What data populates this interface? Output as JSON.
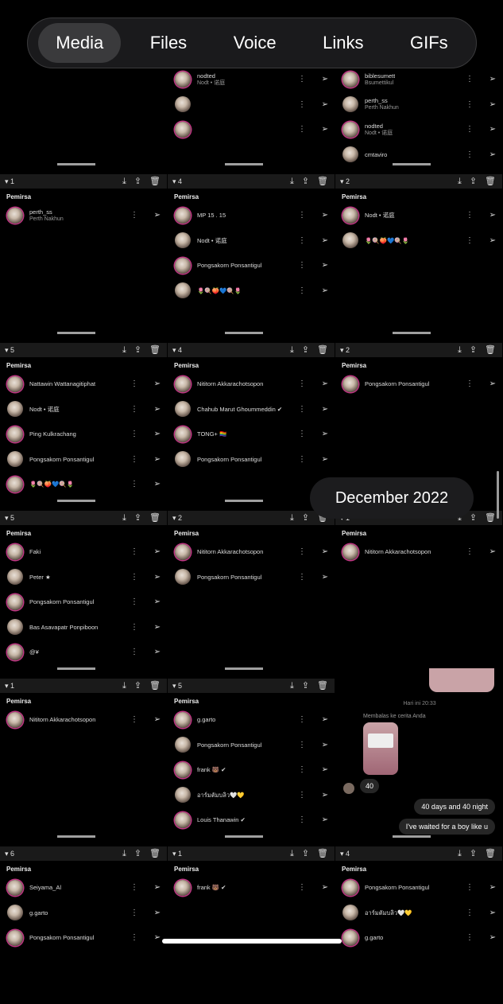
{
  "tabs": [
    "Media",
    "Files",
    "Voice",
    "Links",
    "GIFs"
  ],
  "date_label": "December 2022",
  "section_title": "Pemirsa",
  "row0": {
    "c1": [
      {
        "name": "nodted",
        "sub": "Nodt • 诺庭"
      },
      {
        "name": "",
        "sub": ""
      },
      {
        "name": "",
        "sub": ""
      }
    ],
    "c2": [
      {
        "name": "biblesumett",
        "sub": "Bsumettikul"
      },
      {
        "name": "perth_ss",
        "sub": "Perth Nakhun"
      },
      {
        "name": "nodted",
        "sub": "Nodt • 诺庭"
      },
      {
        "name": "cmtaviro",
        "sub": ""
      }
    ]
  },
  "rows": [
    [
      {
        "count": "1",
        "names": [
          "perth_ss|Perth Nakhun"
        ]
      },
      {
        "count": "4",
        "names": [
          "MP 15 . 15",
          "Nodt • 诺庭",
          "Pongsakorn Ponsantigul",
          "🌷🍭🍑💙🍭🌷"
        ]
      },
      {
        "count": "2",
        "names": [
          "Nodt • 诺庭",
          "🌷🍭🍑💙🍭🌷"
        ]
      }
    ],
    [
      {
        "count": "5",
        "names": [
          "Nattawin Wattanagitiphat",
          "Nodt • 诺庭",
          "Ping Kulkrachang",
          "Pongsakorn Ponsantigul",
          "🌷🍭🍑💙🍭🌷"
        ]
      },
      {
        "count": "4",
        "names": [
          "Nititorn Akkarachotsopon",
          "Chahub Marut Ghoummeddin ✔",
          "TONG+ 🏳️‍🌈",
          "Pongsakorn Ponsantigul"
        ]
      },
      {
        "count": "2",
        "names": [
          "Pongsakorn Ponsantigul"
        ]
      }
    ],
    [
      {
        "count": "5",
        "names": [
          "Faki",
          "Peter ★",
          "Pongsakorn Ponsantigul",
          "Bas Asavapatr Ponpiboon",
          "@¥"
        ]
      },
      {
        "count": "2",
        "names": [
          "Nititorn Akkarachotsopon",
          "Pongsakorn Ponsantigul"
        ]
      },
      {
        "count": "1",
        "names": [
          "Nititorn Akkarachotsopon"
        ]
      }
    ],
    [
      {
        "count": "1",
        "names": [
          "Nititorn Akkarachotsopon"
        ]
      },
      {
        "count": "5",
        "names": [
          "g.garto",
          "Pongsakorn Ponsantigul",
          "frank 🐻 ✔",
          "อาร์มตัมบลิว🤍💛",
          "Louis Thanawin ✔"
        ]
      },
      null
    ],
    [
      {
        "count": "6",
        "names": [
          "Seiyama_Al",
          "g.garto",
          "Pongsakorn Ponsantigul"
        ]
      },
      {
        "count": "1",
        "names": [
          "frank 🐻 ✔"
        ]
      },
      {
        "count": "4",
        "names": [
          "Pongsakorn Ponsantigul",
          "อาร์มตัมบลิว🤍💛",
          "g.garto"
        ]
      }
    ]
  ],
  "chat": {
    "time": "Hari ini 20:33",
    "reply_label": "Membalas ke cerita Anda",
    "reply_count": "40",
    "msg1": "40 days and 40 night",
    "msg2": "I've waited for a boy like u"
  },
  "icons": {
    "download": "download-icon",
    "share": "share-icon",
    "trash": "trash-icon",
    "more": "more-icon",
    "send": "send-icon"
  }
}
